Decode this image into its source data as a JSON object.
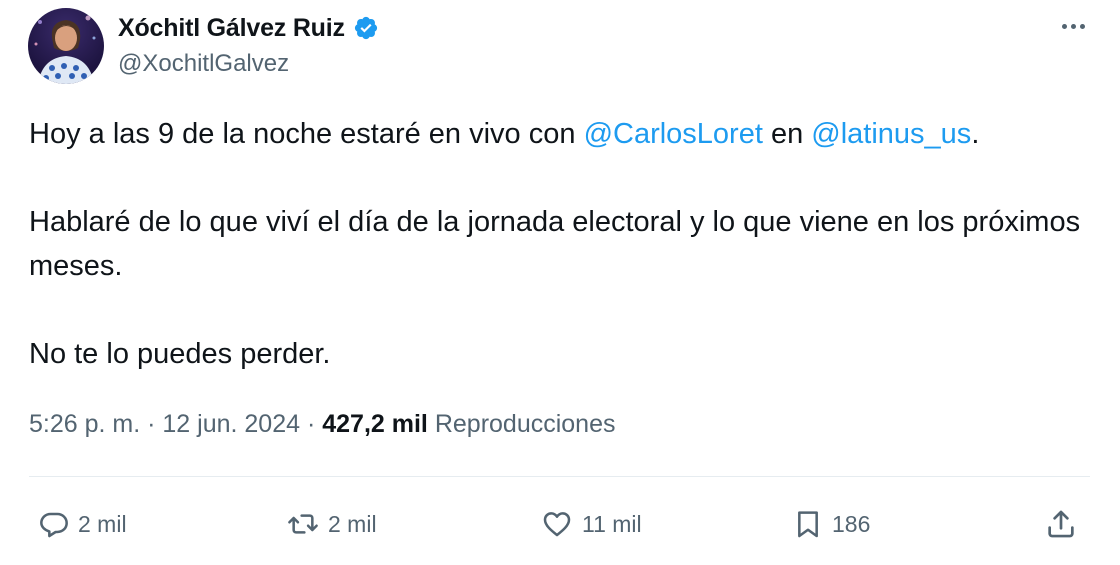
{
  "author": {
    "display_name": "Xóchitl Gálvez Ruiz",
    "handle": "@XochitlGalvez",
    "verified": true
  },
  "tweet": {
    "p1_before": "Hoy a las 9 de la noche estaré en vivo con ",
    "p1_mention1": "@CarlosLoret",
    "p1_middle": " en ",
    "p1_mention2": "@latinus_us",
    "p1_after": ".",
    "p2": "Hablaré de lo que viví el día de la jornada electoral y lo que viene en los próximos meses.",
    "p3": "No te lo puedes perder."
  },
  "meta": {
    "time": "5:26 p. m.",
    "separator": " · ",
    "date": "12 jun. 2024",
    "views_count": "427,2 mil",
    "views_label": "Reproducciones"
  },
  "actions": {
    "replies": "2 mil",
    "reposts": "2 mil",
    "likes": "11 mil",
    "bookmarks": "186"
  },
  "icons": {
    "more": "more-horizontal-icon",
    "verified": "verified-badge-icon",
    "reply": "reply-icon",
    "repost": "repost-icon",
    "like": "heart-icon",
    "bookmark": "bookmark-icon",
    "share": "share-icon"
  },
  "colors": {
    "link": "#1d9bf0",
    "text": "#0f1419",
    "secondary": "#536471",
    "verified": "#1d9bf0"
  }
}
